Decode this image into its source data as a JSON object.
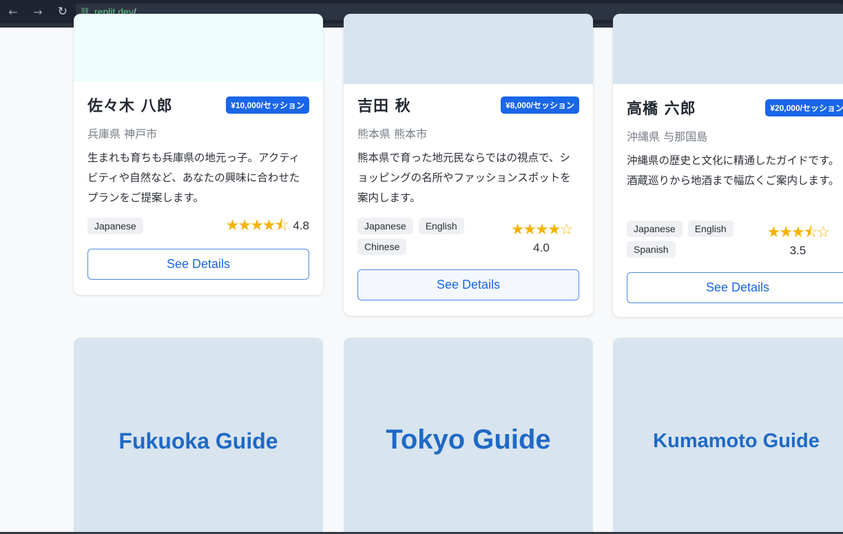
{
  "browser": {
    "url_host": ".replit.dev",
    "url_path": "/"
  },
  "guides": [
    {
      "name": "佐々木 八郎",
      "price": "¥10,000/セッション",
      "location": "兵庫県 神戸市",
      "description": "生まれも育ちも兵庫県の地元っ子。アクティビティや自然など、あなたの興味に合わせたプランをご提案します。",
      "languages": [
        "Japanese"
      ],
      "stars": "★★★★⯪",
      "rating": "4.8",
      "button": "See Details"
    },
    {
      "name": "吉田 秋",
      "price": "¥8,000/セッション",
      "location": "熊本県 熊本市",
      "description": "熊本県で育った地元民ならではの視点で、ショッピングの名所やファッションスポットを案内します。",
      "languages": [
        "Japanese",
        "English",
        "Chinese"
      ],
      "stars": "★★★★☆",
      "rating": "4.0",
      "button": "See Details"
    },
    {
      "name": "高橋 六郎",
      "price": "¥20,000/セッション",
      "location": "沖縄県 与那国島",
      "description": "沖縄県の歴史と文化に精通したガイドです。酒蔵巡りから地酒まで幅広くご案内します。",
      "languages": [
        "Japanese",
        "English",
        "Spanish"
      ],
      "stars": "★★★⯪☆",
      "rating": "3.5",
      "button": "See Details"
    }
  ],
  "city_guides": [
    {
      "title": "Fukuoka Guide"
    },
    {
      "title": "Tokyo Guide"
    },
    {
      "title": "Kumamoto Guide"
    }
  ],
  "colors": {
    "accent": "#1a66e8",
    "star": "#f5b300",
    "tile": "#d8e4ee"
  }
}
